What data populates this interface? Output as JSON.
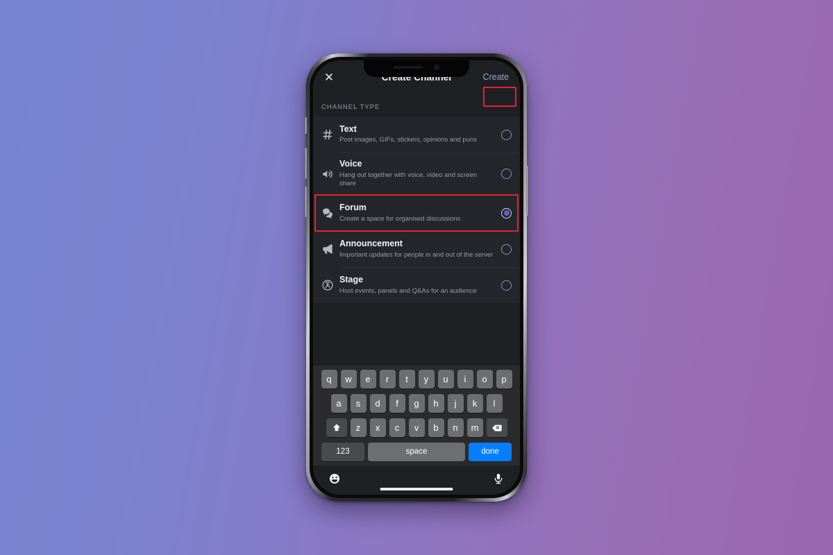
{
  "background": {
    "gradient_from": "#7484d2",
    "gradient_to": "#9a67b0"
  },
  "device": {
    "frame": "iphone-x",
    "notch": true
  },
  "app": {
    "topbar": {
      "close_label": "✕",
      "title": "Create Channel",
      "create_label": "Create",
      "create_color": "#9aa4cf"
    },
    "section_header": "CHANNEL TYPE",
    "channel_types": [
      {
        "id": "text",
        "icon": "hash-icon",
        "title": "Text",
        "description": "Post images, GIFs, stickers, opinions and puns",
        "selected": false
      },
      {
        "id": "voice",
        "icon": "speaker-icon",
        "title": "Voice",
        "description": "Hang out together with voice, video and screen share",
        "selected": false
      },
      {
        "id": "forum",
        "icon": "forum-icon",
        "title": "Forum",
        "description": "Create a space for organised discussions",
        "selected": true,
        "highlighted": true
      },
      {
        "id": "announcement",
        "icon": "megaphone-icon",
        "title": "Announcement",
        "description": "Important updates for people in and out of the server",
        "selected": false
      },
      {
        "id": "stage",
        "icon": "stage-icon",
        "title": "Stage",
        "description": "Host events, panels and Q&As for an audience",
        "selected": false
      }
    ]
  },
  "keyboard": {
    "row1": [
      "q",
      "w",
      "e",
      "r",
      "t",
      "y",
      "u",
      "i",
      "o",
      "p"
    ],
    "row2": [
      "a",
      "s",
      "d",
      "f",
      "g",
      "h",
      "j",
      "k",
      "l"
    ],
    "row3": [
      "z",
      "x",
      "c",
      "v",
      "b",
      "n",
      "m"
    ],
    "shift_icon": "shift-icon",
    "backspace_icon": "backspace-icon",
    "numbers_label": "123",
    "space_label": "space",
    "done_label": "done",
    "done_color": "#067efb"
  },
  "accessory_bar": {
    "emoji_icon": "emoji-icon",
    "mic_icon": "microphone-icon"
  },
  "annotations": {
    "highlight_color": "#e8212b",
    "boxes": [
      "create-button",
      "forum-row"
    ]
  }
}
